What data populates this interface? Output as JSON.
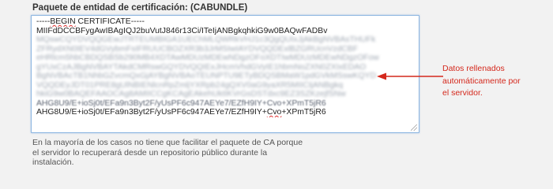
{
  "field": {
    "label": "Paquete de entidad de certificación: (CABUNDLE)"
  },
  "textarea": {
    "first_line_pre": "-----",
    "first_line_word": "BEGIN",
    "first_line_post": " CERTIFICATE-----",
    "lines": [
      "MIIFdDCCBFygAwIBAgIQJ2buVutJ846r13Ci/ITeIjANBgkqhkiG9w0BAQwFADBv",
      "MQswCQYDVQQGEwJTRTEUMBIGA1UEChMLQWRkVHJ1c3QgQUIxJjAkBgNVBAsTHUFk",
      "ZFRydXN0IEV4dGVybmFsIFRUUCBOZXR3b3JrMSIwIAYDVQQDExlBZGRUcnVzdCBF",
      "eHRlcm5hbCBDQSBSb290MB4XDTAwMDUzMDEwNDgzOFoXDTIwMDUzMDEwNDgzOFow",
      "gYUxCzAJBgNVBAYTAkdCMRswGQYDVQQIExJHcmVhdGVyIE1hbmNoZXN0ZXIxEDAO",
      "BgNVBAcTB1NhbGZvcmQxGjAYBgNVBAoTEUNPTU9ETyBDQSBMaW1pdGVkMSswKQYD",
      "VQQDEyJDT01PRE8gUlNBIENlcnRpZmljYXRpb24gQXV0aG9yaXR5MIICIjANBgkq",
      "hkiG9w0BAQEFAAOCAg8AMIICCgKCAgEAkehUktIKVrGsDSTdxc9EZ3SZKzejfSNw",
      "AHG8U9/E+ioSj0t/EFa9n3Byt2F/yUsPF6c947AEYe7/EZfH9IY+Cvo+XPmT5jR6"
    ],
    "last_line_pre": "AHG8U9/E+ioSj0t/EFa9n3Byt2F/yUsPF6c947AEYe7/EZfH9IY+",
    "last_line_word": "Cvo",
    "last_line_post": "+XPmT5jR6"
  },
  "help": {
    "lines": [
      "En la mayoría de los casos no tiene que facilitar el paquete de CA porque",
      "el servidor lo recuperará desde un repositorio público durante la",
      "instalación."
    ]
  },
  "annotation": {
    "color": "#d4281c",
    "lines": [
      "Datos rellenados",
      "automáticamente por",
      "el servidor."
    ]
  }
}
